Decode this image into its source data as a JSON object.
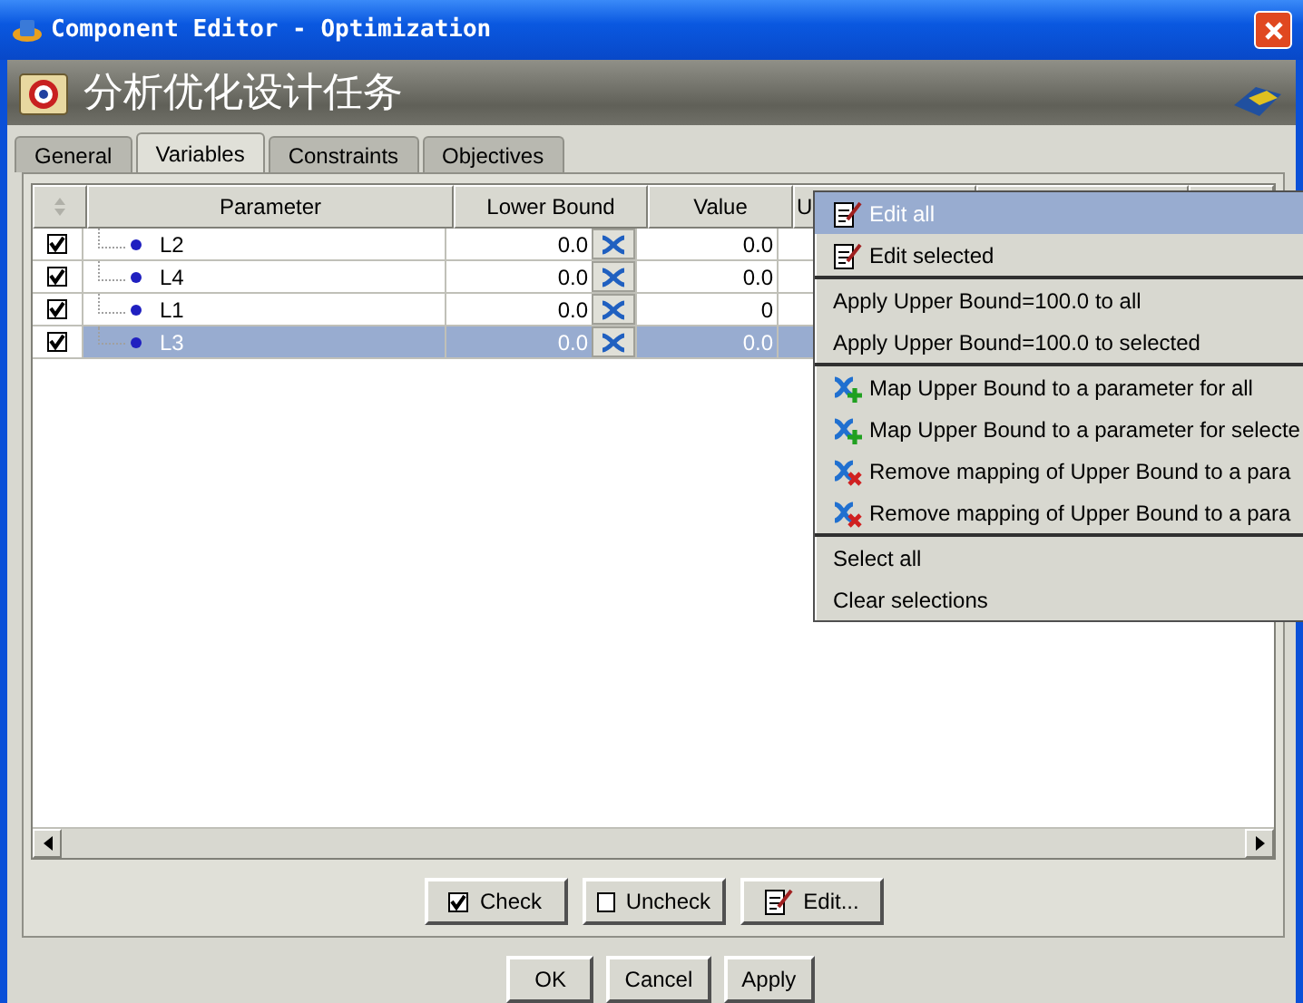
{
  "window": {
    "title": "Component Editor - Optimization"
  },
  "header": {
    "title": "分析优化设计任务"
  },
  "tabs": [
    {
      "label": "General",
      "selected": false
    },
    {
      "label": "Variables",
      "selected": true
    },
    {
      "label": "Constraints",
      "selected": false
    },
    {
      "label": "Objectives",
      "selected": false
    }
  ],
  "table": {
    "columns": [
      "Parameter",
      "Lower Bound",
      "Value",
      "U"
    ],
    "rows": [
      {
        "checked": true,
        "name": "L2",
        "lower": "0.0",
        "value": "0.0",
        "selected": false
      },
      {
        "checked": true,
        "name": "L4",
        "lower": "0.0",
        "value": "0.0",
        "selected": false
      },
      {
        "checked": true,
        "name": "L1",
        "lower": "0.0",
        "value": "0",
        "selected": false
      },
      {
        "checked": true,
        "name": "L3",
        "lower": "0.0",
        "value": "0.0",
        "selected": true
      }
    ]
  },
  "context_menu": {
    "groups": [
      [
        {
          "label": "Edit all",
          "kind": "edit",
          "selected": true
        },
        {
          "label": "Edit selected",
          "kind": "edit",
          "selected": false
        }
      ],
      [
        {
          "label": "Apply Upper Bound=100.0 to all",
          "kind": "plain",
          "selected": false
        },
        {
          "label": "Apply Upper Bound=100.0 to selected",
          "kind": "plain",
          "selected": false
        }
      ],
      [
        {
          "label": "Map Upper Bound to a parameter for all",
          "kind": "map-add",
          "selected": false
        },
        {
          "label": "Map Upper Bound to a parameter for selecte",
          "kind": "map-add",
          "selected": false
        },
        {
          "label": "Remove mapping of Upper Bound to a para",
          "kind": "map-remove",
          "selected": false
        },
        {
          "label": "Remove mapping of Upper Bound to a para",
          "kind": "map-remove",
          "selected": false
        }
      ],
      [
        {
          "label": "Select all",
          "kind": "plain",
          "selected": false
        },
        {
          "label": "Clear selections",
          "kind": "plain",
          "selected": false
        }
      ]
    ]
  },
  "panel_buttons": [
    {
      "label": "Check",
      "kind": "check"
    },
    {
      "label": "Uncheck",
      "kind": "uncheck"
    },
    {
      "label": "Edit...",
      "kind": "edit"
    }
  ],
  "dialog_buttons": [
    "OK",
    "Cancel",
    "Apply"
  ]
}
